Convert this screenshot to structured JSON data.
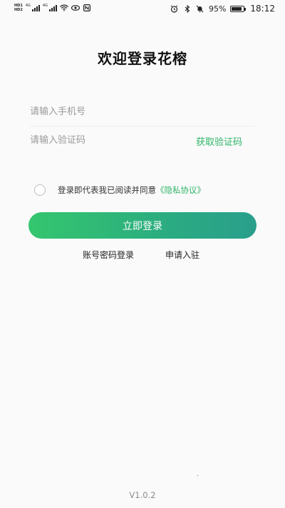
{
  "status_bar": {
    "hd1": "HD",
    "hd1_sub": "1",
    "hd2": "HD",
    "hd2_sub": "2",
    "net1": "4G",
    "net2": "4G",
    "battery_percent": "95%",
    "battery_level": 0.95,
    "time": "18:12",
    "icons": [
      "wifi-icon",
      "eye-icon",
      "nfc-icon",
      "alarm-icon",
      "bluetooth-icon",
      "mute-icon",
      "battery-icon"
    ]
  },
  "title": "欢迎登录花榕",
  "phone_input": {
    "placeholder": "请输入手机号",
    "value": ""
  },
  "code_input": {
    "placeholder": "请输入验证码",
    "value": ""
  },
  "get_code_label": "获取验证码",
  "agreement": {
    "checked": false,
    "text": "登录即代表我已阅读并同意",
    "link": "《隐私协议》"
  },
  "login_button": "立即登录",
  "password_login": "账号密码登录",
  "apply_join": "申请入驻",
  "version": "V1.0.2",
  "colors": {
    "accent": "#2fb568",
    "button_start": "#34c66e",
    "button_end": "#2a9f8c"
  }
}
